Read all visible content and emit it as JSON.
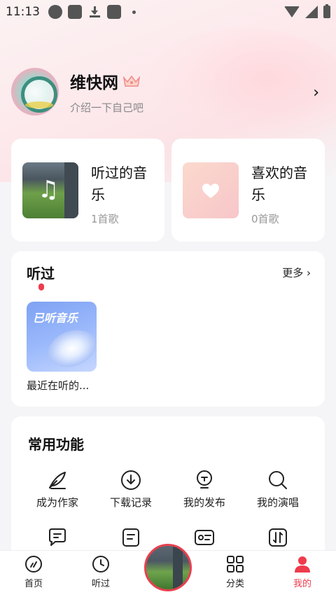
{
  "status_bar": {
    "time": "11:13"
  },
  "profile": {
    "username": "维快网",
    "bio": "介绍一下自己吧"
  },
  "music_cards": [
    {
      "title": "听过的音乐",
      "count": "1首歌"
    },
    {
      "title": "喜欢的音乐",
      "count": "0首歌"
    }
  ],
  "history": {
    "title": "听过",
    "more": "更多",
    "item": {
      "cover_text": "已听音乐",
      "label": "最近在听的..."
    }
  },
  "functions": {
    "title": "常用功能",
    "items": [
      {
        "label": "成为作家",
        "icon": "feather-icon"
      },
      {
        "label": "下载记录",
        "icon": "download-icon"
      },
      {
        "label": "我的发布",
        "icon": "publish-icon"
      },
      {
        "label": "我的演唱",
        "icon": "search-icon"
      }
    ]
  },
  "bottom_nav": [
    {
      "label": "首页",
      "icon": "home-icon",
      "active": false
    },
    {
      "label": "听过",
      "icon": "clock-icon",
      "active": false
    },
    {
      "label": "分类",
      "icon": "grid-icon",
      "active": false
    },
    {
      "label": "我的",
      "icon": "user-icon",
      "active": true
    }
  ],
  "colors": {
    "accent": "#ee3b4d",
    "background": "#f5f5f7",
    "card": "#ffffff"
  }
}
